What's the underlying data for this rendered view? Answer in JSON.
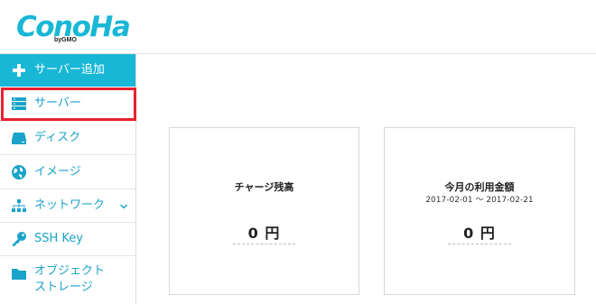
{
  "brand": {
    "logo_text": "ConoHa",
    "logo_sub": "byGMO",
    "accent": "#19b7d6"
  },
  "sidebar": {
    "items": [
      {
        "label": "サーバー追加",
        "icon": "plus-icon"
      },
      {
        "label": "サーバー",
        "icon": "server-icon"
      },
      {
        "label": "ディスク",
        "icon": "disk-icon"
      },
      {
        "label": "イメージ",
        "icon": "globe-icon"
      },
      {
        "label": "ネットワーク",
        "icon": "network-icon"
      },
      {
        "label": "SSH Key",
        "icon": "key-icon"
      },
      {
        "label": "オブジェクト",
        "label2": "ストレージ",
        "icon": "folder-icon"
      }
    ]
  },
  "cards": {
    "charge": {
      "title": "チャージ残高",
      "amount": "0 円"
    },
    "usage": {
      "title": "今月の利用金額",
      "period": "2017-02-01 ～ 2017-02-21",
      "amount": "0 円"
    }
  },
  "colors": {
    "highlight": "#e8212d",
    "sidebar_text": "#1aa3c8"
  }
}
